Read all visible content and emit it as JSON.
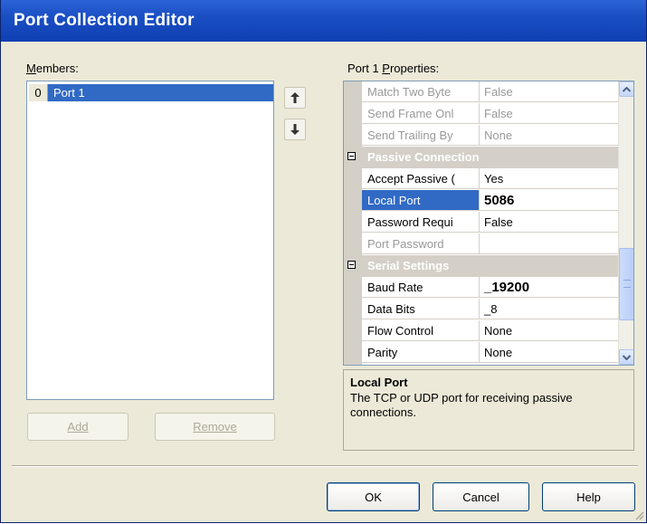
{
  "window": {
    "title": "Port Collection Editor"
  },
  "members": {
    "label_prefix": "",
    "label_access": "M",
    "label_rest": "embers:",
    "items": [
      {
        "index": "0",
        "name": "Port 1"
      }
    ],
    "add_label": "Add",
    "remove_label": "Remove"
  },
  "properties": {
    "label_prefix": "Port 1 ",
    "label_access": "P",
    "label_rest": "roperties:",
    "rows": [
      {
        "name": "Match Two Byte",
        "value": "False"
      },
      {
        "name": "Send Frame Onl",
        "value": "False"
      },
      {
        "name": "Send Trailing By",
        "value": "None"
      },
      {
        "category": "Passive Connection"
      },
      {
        "name": "Accept Passive (",
        "value": "Yes"
      },
      {
        "name": "Local Port",
        "value": "5086"
      },
      {
        "name": "Password Requi",
        "value": "False"
      },
      {
        "name": "Port Password",
        "value": ""
      },
      {
        "category": "Serial Settings"
      },
      {
        "name": "Baud Rate",
        "value": "_19200"
      },
      {
        "name": "Data Bits",
        "value": "_8"
      },
      {
        "name": "Flow Control",
        "value": "None"
      },
      {
        "name": "Parity",
        "value": "None"
      }
    ],
    "description": {
      "title": "Local Port",
      "text": "The TCP or UDP port for receiving passive connections."
    }
  },
  "buttons": {
    "ok": "OK",
    "cancel": "Cancel",
    "help": "Help"
  }
}
